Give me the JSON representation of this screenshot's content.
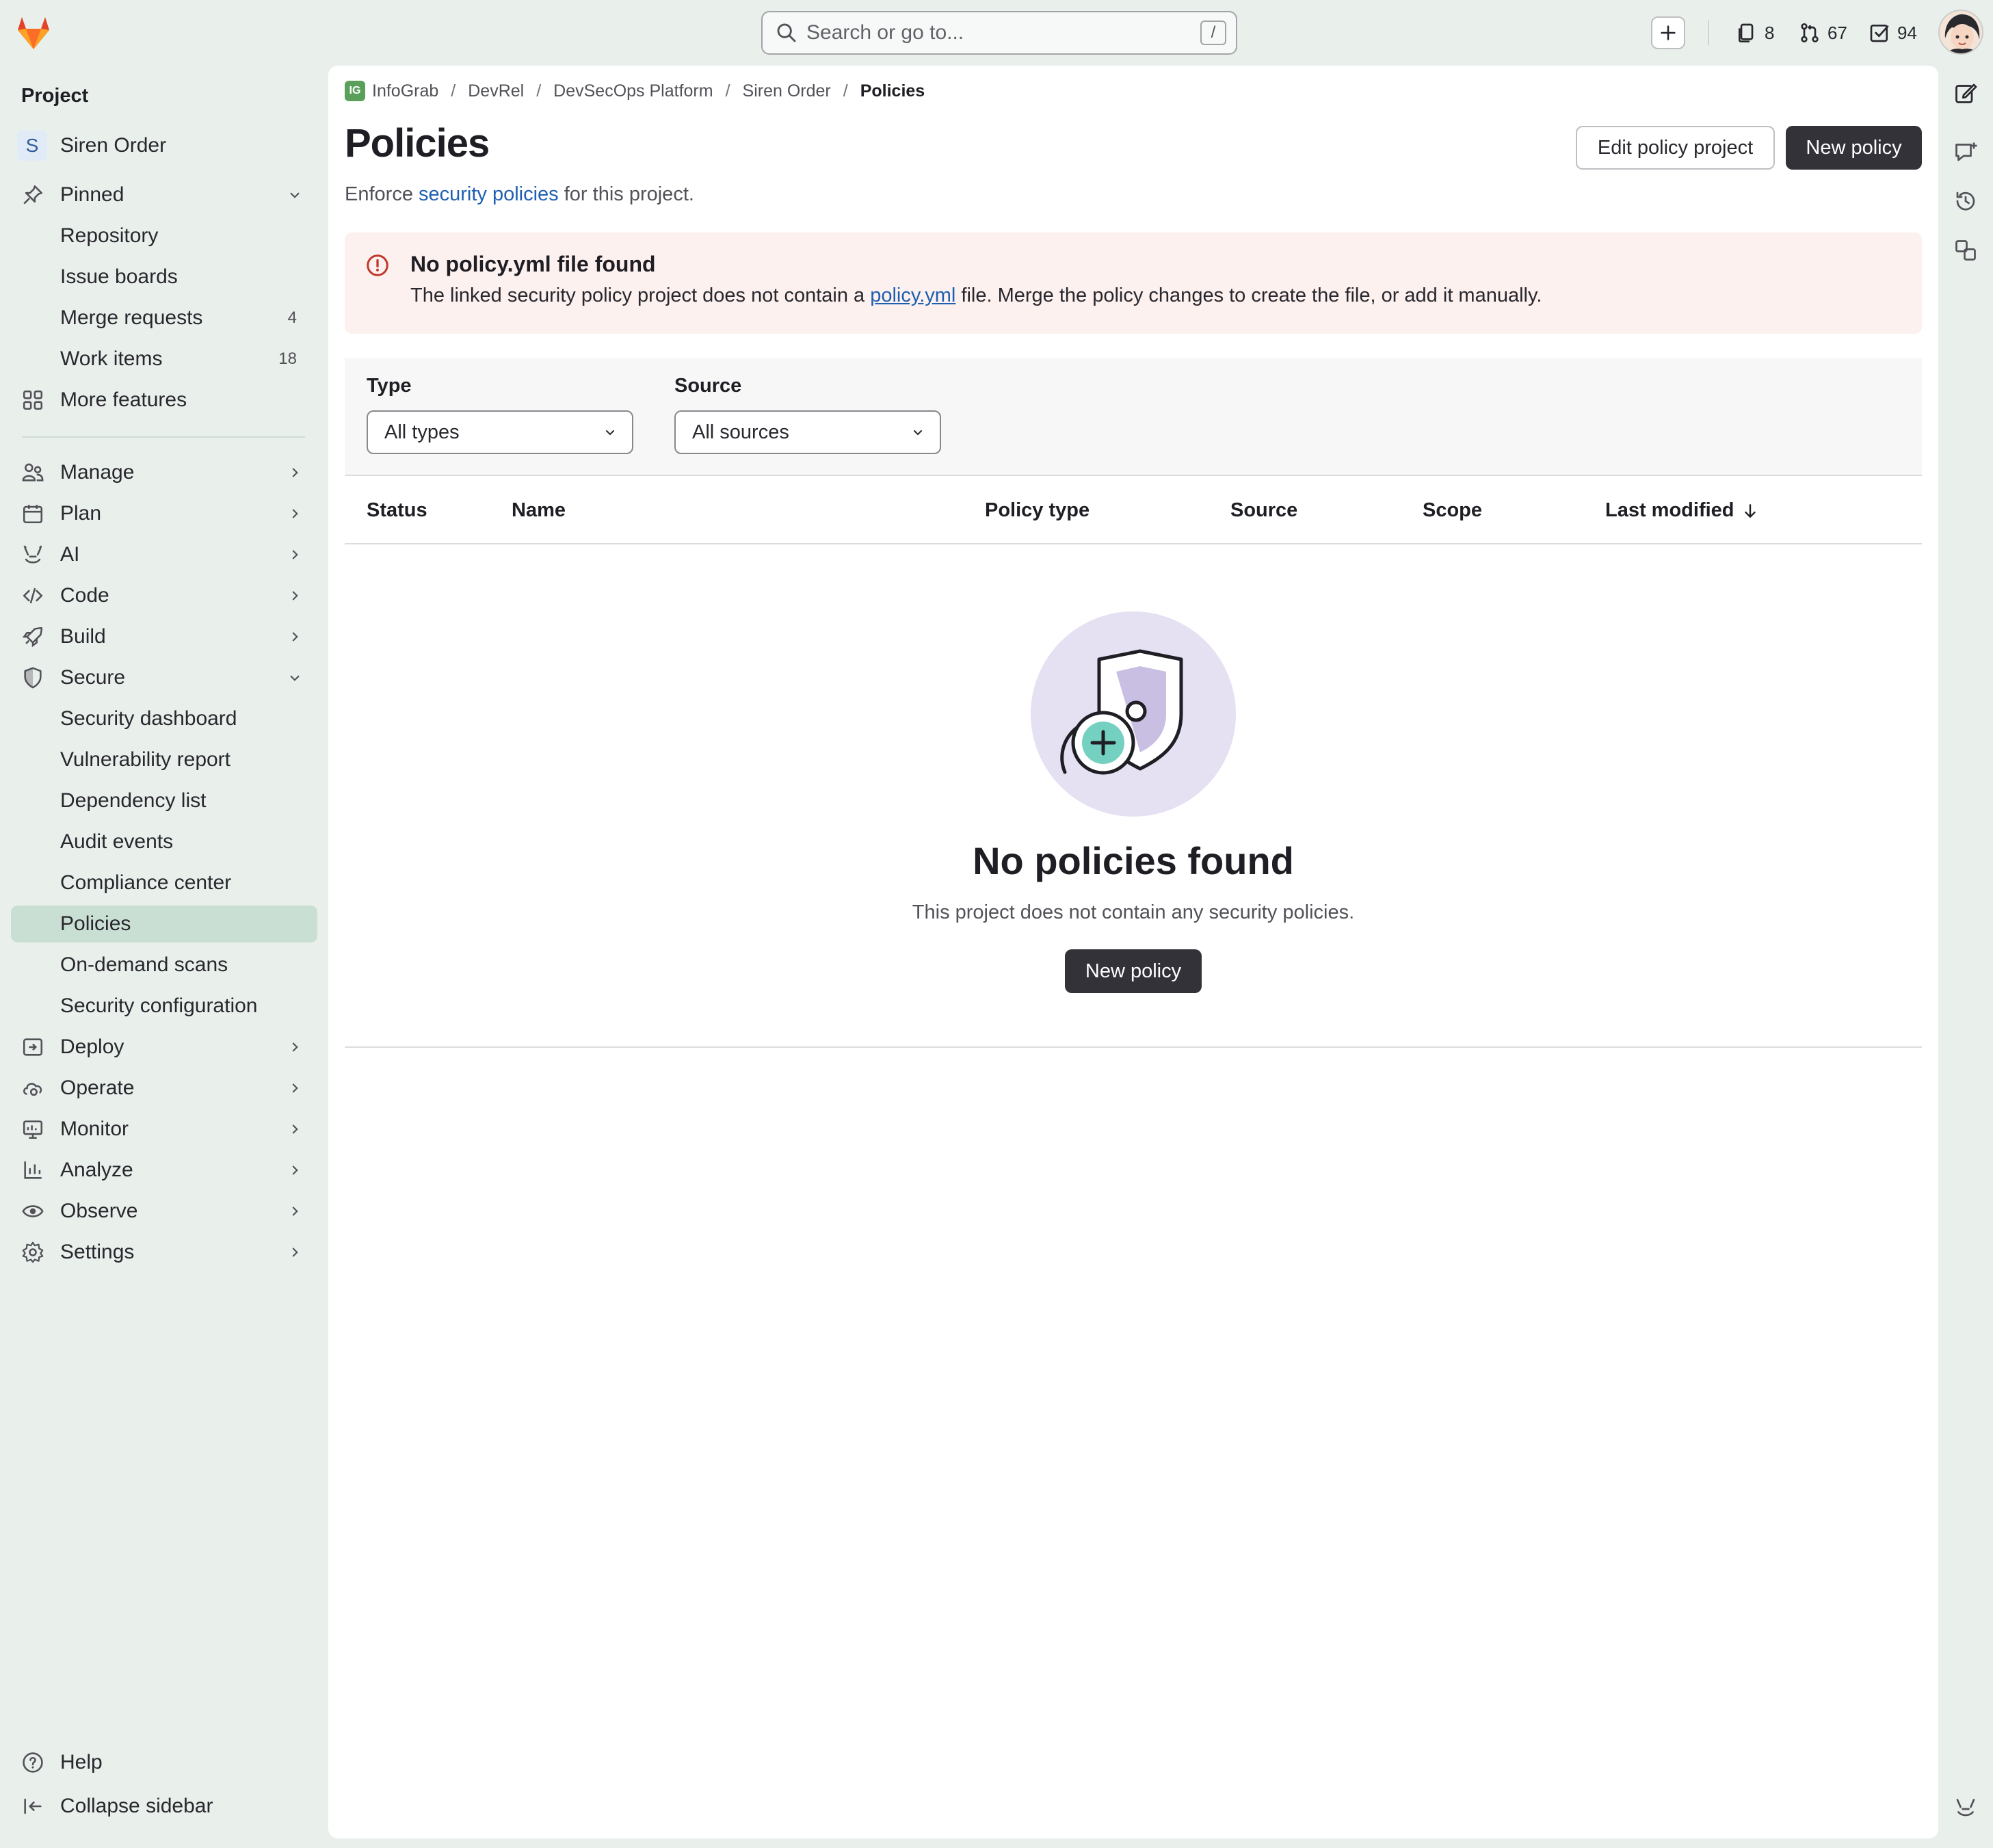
{
  "topbar": {
    "search_placeholder": "Search or go to...",
    "search_shortcut": "/",
    "issues_count": "8",
    "merge_requests_count": "67",
    "todos_count": "94"
  },
  "sidebar": {
    "heading": "Project",
    "project_initial": "S",
    "project_name": "Siren Order",
    "pinned": {
      "label": "Pinned",
      "items": [
        {
          "label": "Repository",
          "count": ""
        },
        {
          "label": "Issue boards",
          "count": ""
        },
        {
          "label": "Merge requests",
          "count": "4"
        },
        {
          "label": "Work items",
          "count": "18"
        }
      ]
    },
    "more_features": "More features",
    "sections": {
      "manage": "Manage",
      "plan": "Plan",
      "ai": "AI",
      "code": "Code",
      "build": "Build",
      "secure": "Secure",
      "deploy": "Deploy",
      "operate": "Operate",
      "monitor": "Monitor",
      "analyze": "Analyze",
      "observe": "Observe",
      "settings": "Settings"
    },
    "secure_items": [
      "Security dashboard",
      "Vulnerability report",
      "Dependency list",
      "Audit events",
      "Compliance center",
      "Policies",
      "On-demand scans",
      "Security configuration"
    ],
    "help": "Help",
    "collapse": "Collapse sidebar"
  },
  "breadcrumb": {
    "badge": "IG",
    "items": [
      "InfoGrab",
      "DevRel",
      "DevSecOps Platform",
      "Siren Order",
      "Policies"
    ],
    "separator": "/"
  },
  "page": {
    "title": "Policies",
    "desc_prefix": "Enforce ",
    "desc_link": "security policies",
    "desc_suffix": " for this project.",
    "edit_button": "Edit policy project",
    "new_button": "New policy"
  },
  "alert": {
    "title": "No policy.yml file found",
    "body_prefix": "The linked security policy project does not contain a ",
    "body_link": "policy.yml",
    "body_suffix": " file. Merge the policy changes to create the file, or add it manually."
  },
  "filters": {
    "type_label": "Type",
    "type_value": "All types",
    "source_label": "Source",
    "source_value": "All sources"
  },
  "table": {
    "columns": [
      "Status",
      "Name",
      "Policy type",
      "Source",
      "Scope",
      "Last modified"
    ]
  },
  "empty_state": {
    "title": "No policies found",
    "description": "This project does not contain any security policies.",
    "button": "New policy"
  },
  "colors": {
    "sidebar_bg": "#e9f0ec",
    "active_item_bg": "#c9dfd3",
    "link": "#1f5fb0",
    "alert_bg": "#fcf1ef",
    "danger": "#c0392b",
    "button_dark": "#333238"
  }
}
